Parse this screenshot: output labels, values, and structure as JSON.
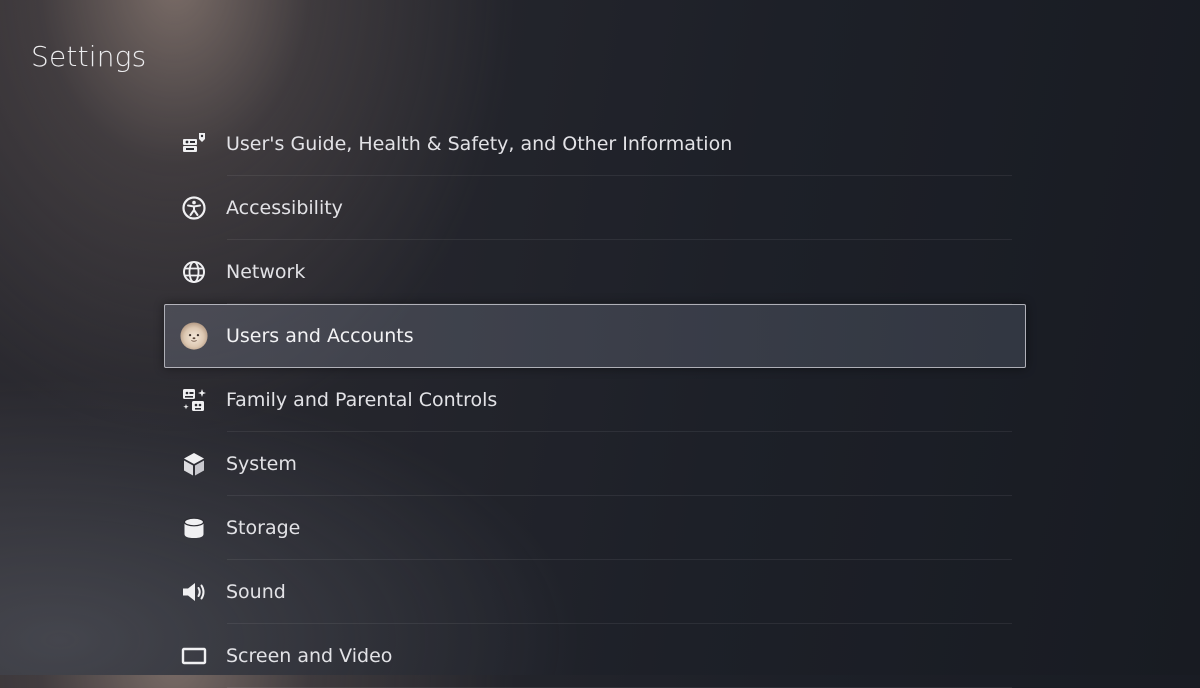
{
  "page": {
    "title": "Settings"
  },
  "menu": {
    "items": [
      {
        "label": "User's Guide, Health & Safety, and Other Information",
        "icon": "info-book-icon"
      },
      {
        "label": "Accessibility",
        "icon": "accessibility-icon"
      },
      {
        "label": "Network",
        "icon": "globe-icon"
      },
      {
        "label": "Users and Accounts",
        "icon": "user-avatar-icon",
        "selected": true
      },
      {
        "label": "Family and Parental Controls",
        "icon": "family-icon"
      },
      {
        "label": "System",
        "icon": "cube-icon"
      },
      {
        "label": "Storage",
        "icon": "storage-cylinder-icon"
      },
      {
        "label": "Sound",
        "icon": "speaker-icon"
      },
      {
        "label": "Screen and Video",
        "icon": "screen-icon"
      }
    ]
  },
  "colors": {
    "text": "#e2e2e6",
    "selection_border": "#d7d7de",
    "background_dark": "#181b22"
  }
}
